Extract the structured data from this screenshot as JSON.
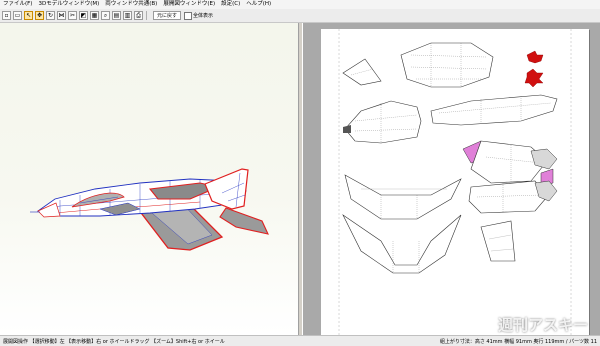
{
  "menu": [
    "ファイル(F)",
    "3Dモデルウィンドウ(M)",
    "両ウィンドウ共通(B)",
    "展開図ウィンドウ(E)",
    "設定(C)",
    "ヘルプ(H)"
  ],
  "toolbar": {
    "text_button": "元に戻す",
    "checkbox_label": "全体表示"
  },
  "status": {
    "left": "展開図操作 【選択移動】左 【表示移動】右 or ホイールドラッグ 【ズーム】Shift+右 or ホイール",
    "right": "組上がり寸法：高さ 41mm 横幅 91mm 奥行 119mm / パーツ数 11"
  },
  "watermark": "週刊アスキー",
  "colors": {
    "model_edge_red": "#e02020",
    "model_edge_blue": "#2030c0",
    "model_fill_gray": "#9a9a9a",
    "part_highlight_pink": "#e080d8",
    "part_marker_red": "#d01010"
  }
}
